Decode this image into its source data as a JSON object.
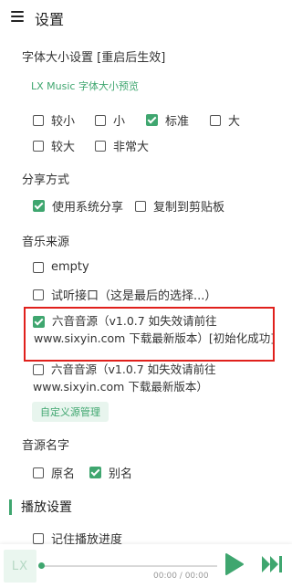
{
  "header": {
    "title": "设置",
    "menu_icon": "hamburger-menu-icon"
  },
  "font_size": {
    "label": "字体大小设置 [重启后生效]",
    "preview": "LX Music 字体大小预览",
    "options": [
      {
        "label": "较小",
        "checked": false
      },
      {
        "label": "小",
        "checked": false
      },
      {
        "label": "标准",
        "checked": true
      },
      {
        "label": "大",
        "checked": false
      },
      {
        "label": "较大",
        "checked": false
      },
      {
        "label": "非常大",
        "checked": false
      }
    ]
  },
  "share": {
    "label": "分享方式",
    "options": [
      {
        "label": "使用系统分享",
        "checked": true
      },
      {
        "label": "复制到剪贴板",
        "checked": false
      }
    ]
  },
  "music_source": {
    "label": "音乐来源",
    "options": [
      {
        "label": "empty",
        "checked": false
      },
      {
        "label": "试听接口（这是最后的选择...）",
        "checked": false
      },
      {
        "label_line1": "六音音源（v1.0.7 如失效请前往",
        "label_line2": "www.sixyin.com 下载最新版本）[初始化成功]",
        "checked": true,
        "highlighted": true
      },
      {
        "label_line1": "六音音源（v1.0.7 如失效请前往",
        "label_line2": "www.sixyin.com 下载最新版本）",
        "checked": false
      }
    ],
    "custom_button": "自定义源管理"
  },
  "source_name": {
    "label": "音源名字",
    "options": [
      {
        "label": "原名",
        "checked": false
      },
      {
        "label": "别名",
        "checked": true
      }
    ]
  },
  "playback": {
    "section_title": "播放设置",
    "options": [
      {
        "label": "记住播放进度",
        "checked": false
      }
    ]
  },
  "player": {
    "logo_text": "LX",
    "time": "00:00 / 00:00",
    "progress": 0,
    "play_icon": "play-icon",
    "next_icon": "next-track-icon"
  },
  "colors": {
    "accent": "#3fa66f",
    "highlight_border": "#e0201c"
  }
}
